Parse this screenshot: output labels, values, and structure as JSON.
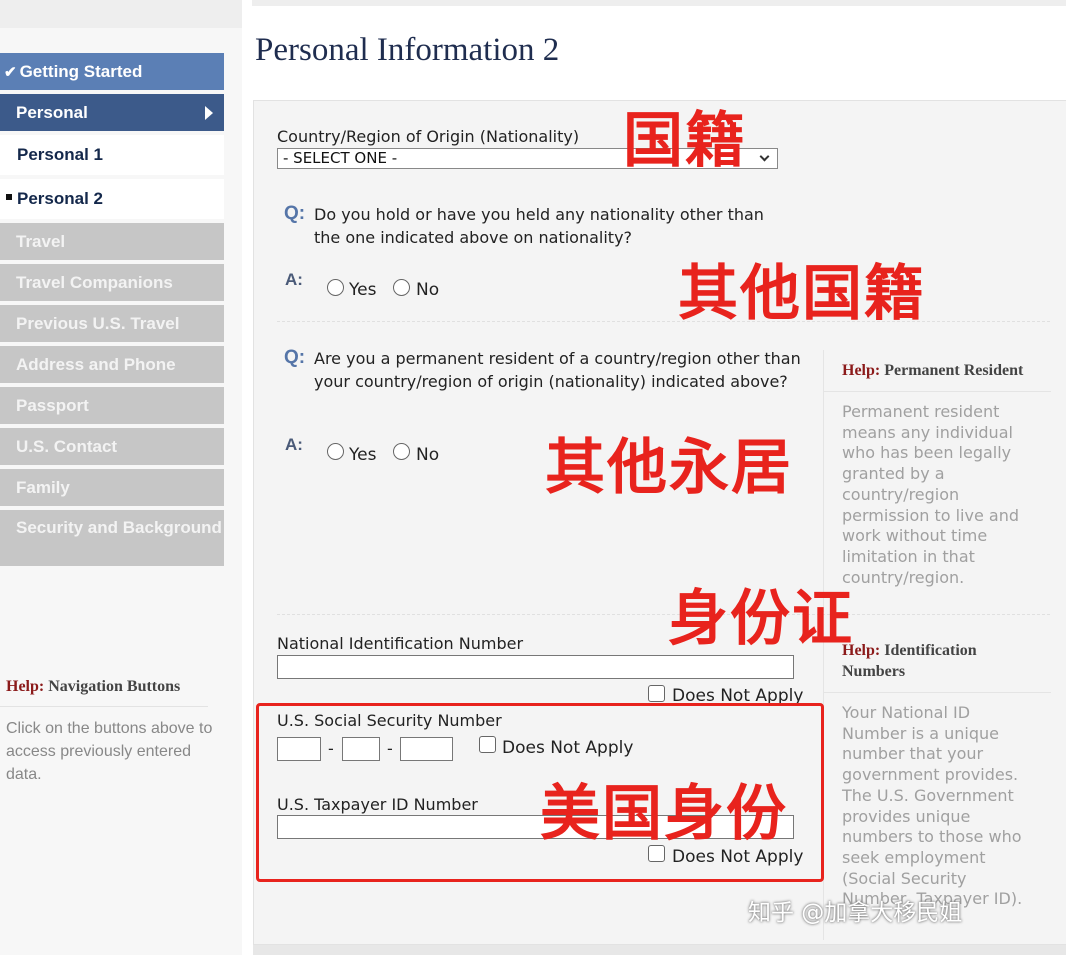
{
  "nav": {
    "items": [
      {
        "label": "Getting Started",
        "state": "done"
      },
      {
        "label": "Personal",
        "state": "active"
      },
      {
        "label": "Personal 1",
        "state": "sub"
      },
      {
        "label": "Personal 2",
        "state": "sub-current"
      },
      {
        "label": "Travel",
        "state": "disabled"
      },
      {
        "label": "Travel Companions",
        "state": "disabled"
      },
      {
        "label": "Previous U.S. Travel",
        "state": "disabled"
      },
      {
        "label": "Address and Phone",
        "state": "disabled"
      },
      {
        "label": "Passport",
        "state": "disabled"
      },
      {
        "label": "U.S. Contact",
        "state": "disabled"
      },
      {
        "label": "Family",
        "state": "disabled"
      },
      {
        "label": "Security and Background",
        "state": "disabled"
      }
    ],
    "check": "✔",
    "help": {
      "prefix": "Help:",
      "title": "Navigation Buttons",
      "body": "Click on the buttons above to access previously entered data."
    }
  },
  "page": {
    "title": "Personal Information 2"
  },
  "form": {
    "nationality": {
      "label": "Country/Region of Origin (Nationality)",
      "selected": "- SELECT ONE -"
    },
    "q1": {
      "q": "Q:",
      "a": "A:",
      "text": "Do you hold or have you held any nationality other than the one indicated above on nationality?",
      "yes": "Yes",
      "no": "No"
    },
    "q2": {
      "q": "Q:",
      "a": "A:",
      "text": "Are you a permanent resident of a country/region other than your country/region of origin (nationality) indicated above?",
      "yes": "Yes",
      "no": "No"
    },
    "national_id": {
      "label": "National Identification Number",
      "value": "",
      "na": "Does Not Apply"
    },
    "ssn": {
      "label": "U.S. Social Security Number",
      "dash": "-",
      "part1": "",
      "part2": "",
      "part3": "",
      "na": "Does Not Apply"
    },
    "taxpayer": {
      "label": "U.S. Taxpayer ID Number",
      "value": "",
      "na": "Does Not Apply"
    }
  },
  "help_panels": {
    "permanent_resident": {
      "prefix": "Help:",
      "title": "Permanent Resident",
      "body": "Permanent resident means any individual who has been legally granted by a country/region permission to live and work without time limitation in that country/region."
    },
    "identification": {
      "prefix": "Help:",
      "title": "Identification Numbers",
      "body": "Your National ID Number is a unique number that your government provides. The U.S. Government provides unique numbers to those who seek employment (Social Security Number, Taxpayer ID)."
    }
  },
  "annotations": {
    "nationality": "国籍",
    "other_nationality": "其他国籍",
    "other_residence": "其他永居",
    "id_card": "身份证",
    "us_id": "美国身份"
  },
  "watermark": "知乎 @加拿大移民姐",
  "colors": {
    "accent_red": "#e8231d",
    "nav_active": "#3c5a8a",
    "nav_done": "#5b7fb5",
    "nav_disabled": "#c6c6c6"
  }
}
